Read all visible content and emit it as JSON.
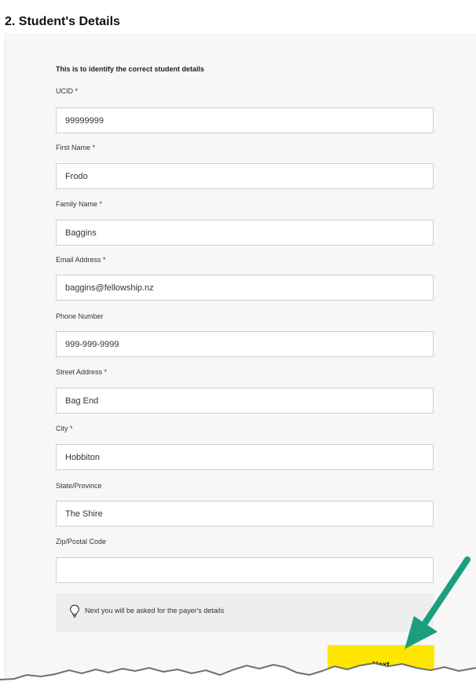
{
  "section": {
    "title": "2. Student's Details",
    "intro": "This is to identify the correct student details"
  },
  "fields": [
    {
      "label": "UCID *",
      "value": "99999999"
    },
    {
      "label": "First Name *",
      "value": "Frodo"
    },
    {
      "label": "Family Name *",
      "value": "Baggins"
    },
    {
      "label": "Email Address *",
      "value": "baggins@fellowship.nz"
    },
    {
      "label": "Phone Number",
      "value": "999-999-9999"
    },
    {
      "label": "Street Address *",
      "value": "Bag End"
    },
    {
      "label": "City *",
      "value": "Hobbiton"
    },
    {
      "label": "State/Province",
      "value": "The Shire"
    },
    {
      "label": "Zip/Postal Code",
      "value": ""
    }
  ],
  "hint": {
    "text": "Next you will be asked for the payer's details",
    "icon": "lightbulb-icon"
  },
  "next_button": {
    "label": "Next",
    "color": "#ffe600"
  },
  "annotation": {
    "icon": "arrow-icon",
    "color": "#1a9e80"
  }
}
